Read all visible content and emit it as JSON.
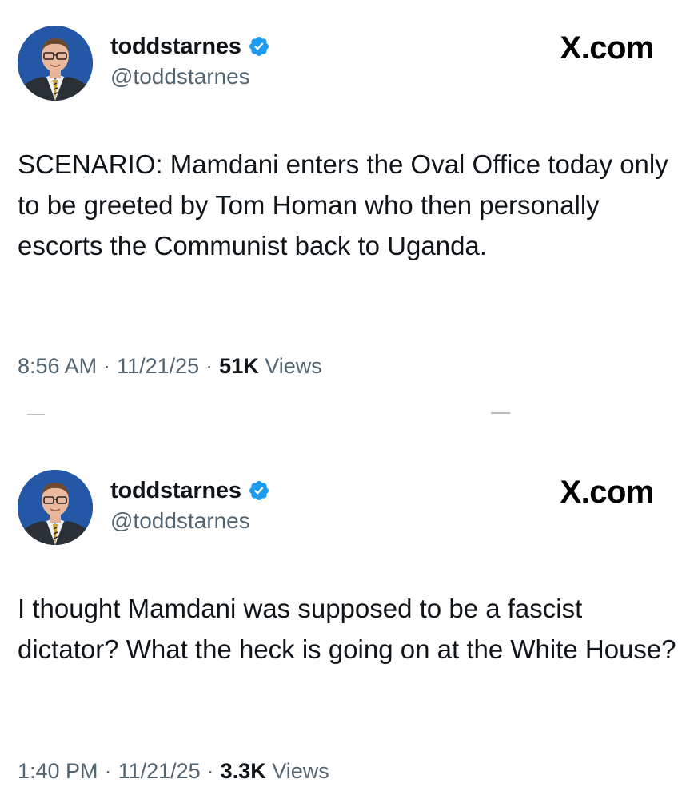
{
  "tweets": [
    {
      "author": {
        "display_name": "toddstarnes",
        "handle": "@toddstarnes",
        "verified_icon": "verified-badge-icon",
        "avatar": "profile-photo"
      },
      "source_label": "X.com",
      "text": "SCENARIO: Mamdani enters the Oval Office today only to be greeted by Tom Homan who then personally escorts the Communist back to Uganda.",
      "time": "8:56 AM",
      "separator": "·",
      "date": "11/21/25",
      "views_count": "51K",
      "views_label": "Views"
    },
    {
      "author": {
        "display_name": "toddstarnes",
        "handle": "@toddstarnes",
        "verified_icon": "verified-badge-icon",
        "avatar": "profile-photo"
      },
      "source_label": "X.com",
      "text": "I thought Mamdani was supposed to be a fascist dictator? What the heck is going on at the White House?",
      "time": "1:40 PM",
      "separator": "·",
      "date": "11/21/25",
      "views_count": "3.3K",
      "views_label": "Views"
    }
  ],
  "colors": {
    "text_primary": "#0f1419",
    "text_secondary": "#536471",
    "verified_blue": "#1d9bf0",
    "avatar_background": "#2557a7"
  }
}
